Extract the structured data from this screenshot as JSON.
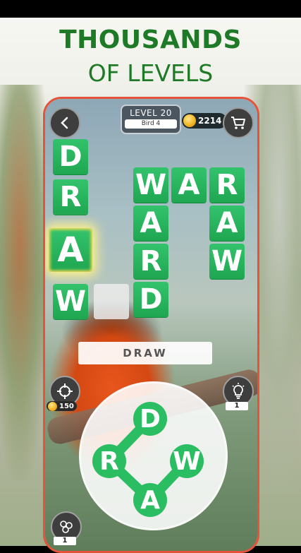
{
  "headline": {
    "line1": "THOUSANDS",
    "line2": "OF LEVELS"
  },
  "topbar": {
    "level": "LEVEL 20",
    "sublevel": "Bird 4",
    "coins": "2214"
  },
  "board": {
    "tiles": {
      "draw_vertical": [
        "D",
        "R",
        "A",
        "W"
      ],
      "war": [
        "W",
        "A",
        "R"
      ],
      "ward": [
        "W",
        "A",
        "R",
        "D"
      ],
      "raw": [
        "R",
        "A",
        "W"
      ]
    }
  },
  "current_guess": "DRAW",
  "powerups": {
    "target_cost": "150",
    "hint_count": "1",
    "bulb_count": "1"
  },
  "wheel": {
    "letters": [
      "D",
      "R",
      "W",
      "A"
    ]
  },
  "colors": {
    "accent_green": "#1fa651",
    "headline_green": "#1e7a26",
    "frame": "#e4533a"
  },
  "icons": [
    "back-arrow-icon",
    "cart-icon",
    "coin-icon",
    "crosshair-icon",
    "lightbulb-icon",
    "bulbs-icon"
  ]
}
